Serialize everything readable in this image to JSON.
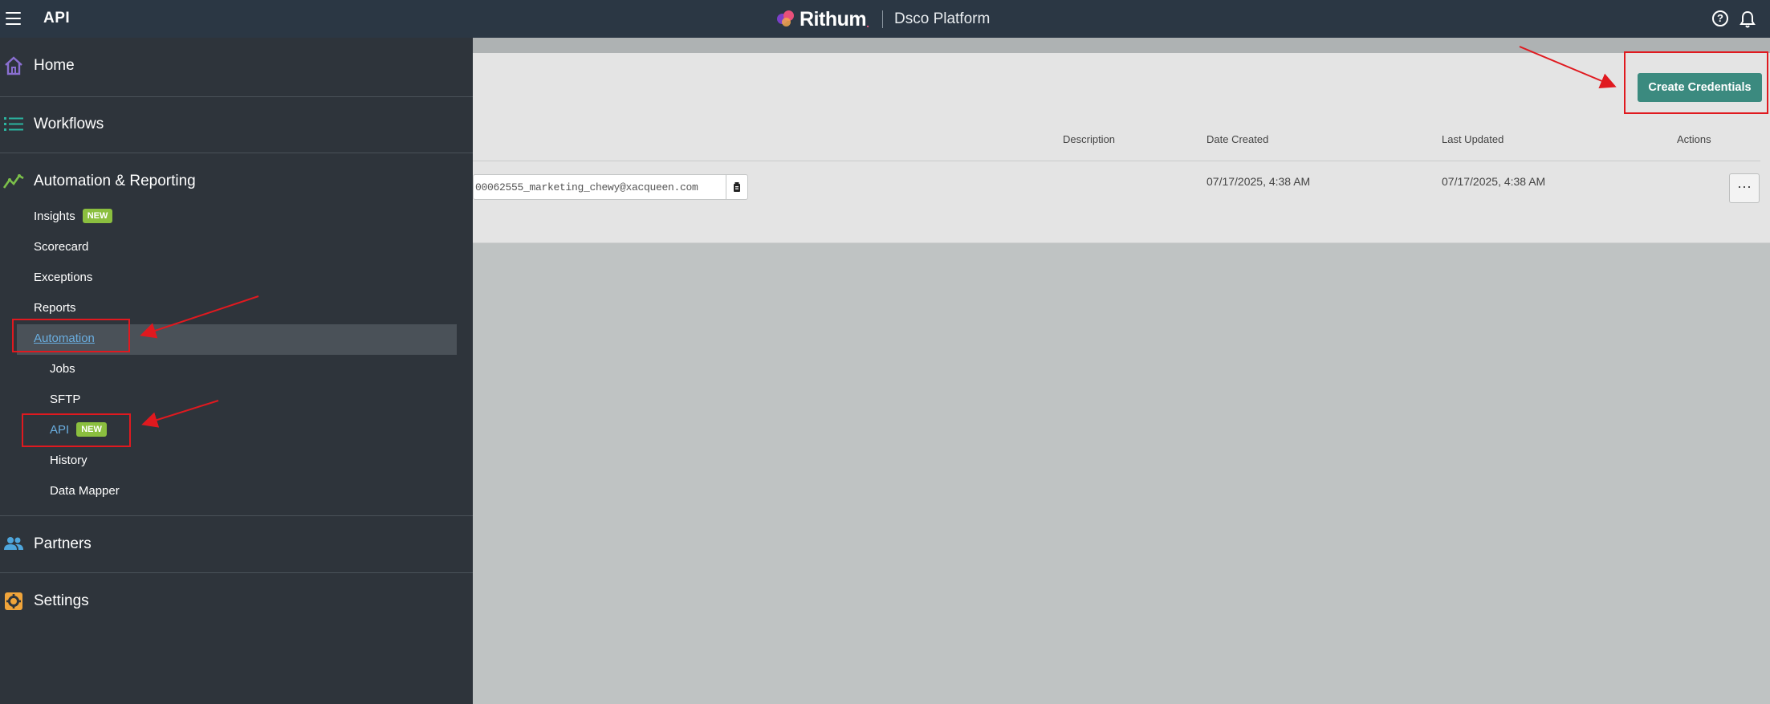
{
  "topbar": {
    "app_title": "API",
    "brand_name": "Rithum",
    "brand_dot": ".",
    "platform": "Dsco Platform",
    "help_glyph": "?"
  },
  "sidebar": {
    "home": "Home",
    "workflows": "Workflows",
    "automation_reporting": "Automation & Reporting",
    "insights": "Insights",
    "insights_badge": "NEW",
    "scorecard": "Scorecard",
    "exceptions": "Exceptions",
    "reports": "Reports",
    "automation": "Automation",
    "jobs": "Jobs",
    "sftp": "SFTP",
    "api": "API",
    "api_badge": "NEW",
    "history": "History",
    "data_mapper": "Data Mapper",
    "partners": "Partners",
    "settings": "Settings"
  },
  "main": {
    "create_button": "Create Credentials",
    "columns": {
      "description": "Description",
      "date_created": "Date Created",
      "last_updated": "Last Updated",
      "actions": "Actions"
    },
    "row": {
      "key_text": "00062555_marketing_chewy@xacqueen.com",
      "date_created": "07/17/2025, 4:38 AM",
      "last_updated": "07/17/2025, 4:38 AM",
      "more": "···"
    }
  },
  "colors": {
    "topbar": "#2b3744",
    "sidebar": "#2e343b",
    "accent_button": "#3b8a7f",
    "badge": "#8bbf3f",
    "annotation": "#e0191f"
  }
}
